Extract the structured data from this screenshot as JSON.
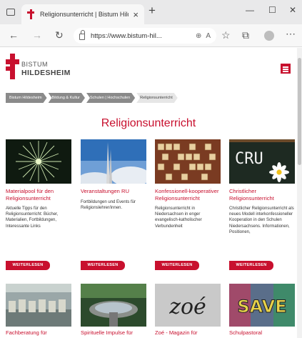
{
  "browser": {
    "tab_title": "Religionsunterricht | Bistum Hildesheim",
    "url": "https://www.bistum-hil..."
  },
  "header": {
    "logo_line1": "BISTUM",
    "logo_line2": "HILDESHEIM"
  },
  "breadcrumbs": [
    "Bistum Hildesheim",
    "Bildung & Kultur",
    "Schulen | Hochschulen",
    "Religionsunterricht"
  ],
  "page": {
    "title": "Religionsunterricht"
  },
  "cards": [
    {
      "title": "Materialpool für den Religionsunterricht",
      "text": "Aktuelle Tipps für den Religionsunterricht: Bücher, Materialien, Fortbildungen, Interessante Links",
      "button": "WEITERLESEN"
    },
    {
      "title": "Veranstaltungen RU",
      "text": "Fortbildungen und Events für Religionslehrer/innen.",
      "button": "WEITERLESEN"
    },
    {
      "title": "Konfessionell-kooperativer Religionsunterricht",
      "text": "Religionsunterricht in Niedersachsen in enger evangelisch-katholischer Verbundenheit",
      "button": "WEITERLESEN"
    },
    {
      "title": "Christlicher Religionsunterricht",
      "text": "Christlicher Religionsunterricht als neues Modell interkonfessioneller Kooperation in den Schulen Niedersachsens. Informationen, Positionen,",
      "button": "WEITERLESEN",
      "image_text": "CRU"
    }
  ],
  "cards_row2": [
    {
      "title": "Fachberatung für"
    },
    {
      "title": "Spirituelle Impulse für"
    },
    {
      "title": "Zoé - Magazin für",
      "image_text": "zoé"
    },
    {
      "title": "Schulpastoral",
      "image_text": "SAVE"
    }
  ],
  "colors": {
    "accent": "#c8102e",
    "breadcrumb": "#8a8a8a"
  }
}
